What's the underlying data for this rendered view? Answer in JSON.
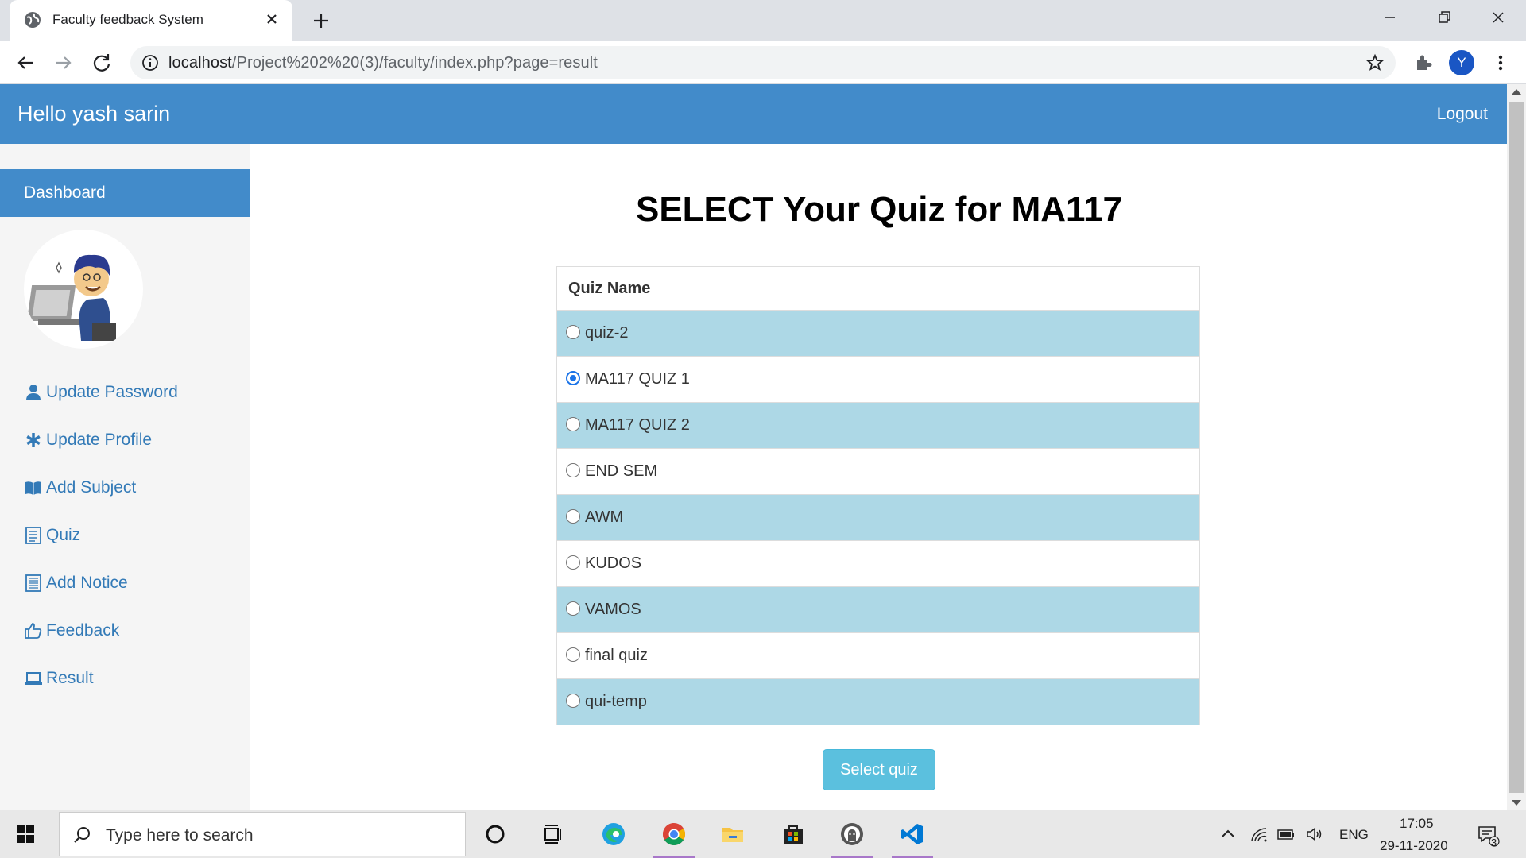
{
  "browser": {
    "tab_title": "Faculty feedback System",
    "url_host": "localhost",
    "url_path": "/Project%202%20(3)/faculty/index.php?page=result",
    "profile_initial": "Y"
  },
  "topnav": {
    "greeting": "Hello yash sarin",
    "logout": "Logout"
  },
  "sidebar": {
    "dashboard": "Dashboard",
    "items": [
      {
        "label": "Update Password",
        "icon": "user-icon"
      },
      {
        "label": "Update Profile",
        "icon": "asterisk-icon"
      },
      {
        "label": "Add Subject",
        "icon": "book-icon"
      },
      {
        "label": "Quiz",
        "icon": "list-icon"
      },
      {
        "label": "Add Notice",
        "icon": "notice-icon"
      },
      {
        "label": "Feedback",
        "icon": "thumbs-up-icon"
      },
      {
        "label": "Result",
        "icon": "laptop-icon"
      }
    ]
  },
  "main": {
    "heading": "SELECT Your Quiz for MA117",
    "table_header": "Quiz Name",
    "quizzes": [
      "quiz-2",
      "MA117 QUIZ 1",
      "MA117 QUIZ 2",
      "END SEM",
      "AWM",
      "KUDOS",
      "VAMOS",
      "final quiz",
      "qui-temp"
    ],
    "selected_quiz": "MA117 QUIZ 1",
    "button": "Select quiz"
  },
  "taskbar": {
    "search_placeholder": "Type here to search",
    "language": "ENG",
    "time": "17:05",
    "date": "29-11-2020",
    "notification_count": "3"
  },
  "colors": {
    "navbar": "#428bca",
    "row_highlight": "#add8e6",
    "button": "#5bc0de",
    "link": "#337ab7"
  }
}
